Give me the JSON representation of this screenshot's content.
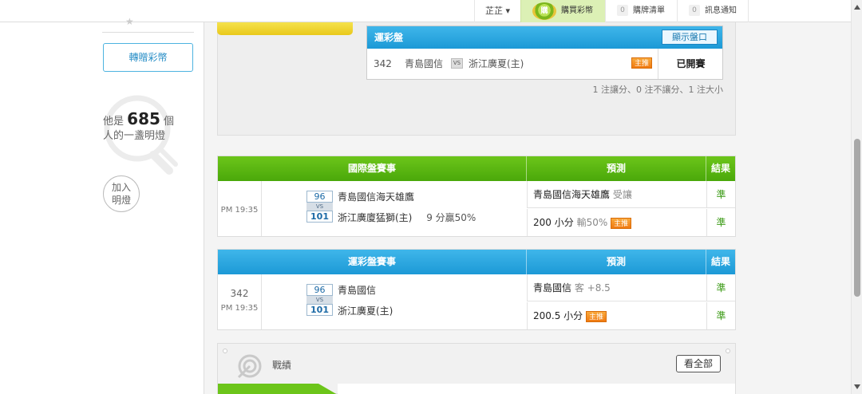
{
  "topbar": {
    "user_name": "芷芷",
    "user_caret": "▾",
    "buy_coin_badge": "購",
    "buy_label": "購買彩幣",
    "cart_count": "0",
    "cart_label": "購牌清單",
    "msg_count": "0",
    "msg_label": "訊息通知"
  },
  "sidebar": {
    "gift_button": "轉贈彩幣",
    "lamp_prefix": "他是",
    "lamp_count": "685",
    "lamp_unit": "個",
    "lamp_suffix": "人的一盞明燈",
    "join_line1": "加入",
    "join_line2": "明燈"
  },
  "lottery_panel": {
    "title": "運彩盤",
    "show_button": "顯示盤口",
    "game_no": "342",
    "team1": "青島國信",
    "vs": "VS",
    "team2": "浙江廣夏(主)",
    "badge": "主推",
    "status": "已開賽",
    "summary": "1 注讓分、0 注不讓分、1 注大小"
  },
  "intl_table": {
    "headers": [
      "國際盤賽事",
      "預測",
      "結果"
    ],
    "game_no": "",
    "time": "PM 19:35",
    "score1": "96",
    "vs": "VS",
    "score2": "101",
    "team1": "青島國信海天雄鷹",
    "team2": "浙江廣廈猛獅(主)",
    "team2_note": "9 分贏50%",
    "pred1_main": "青島國信海天雄鷹",
    "pred1_sub": "受讓",
    "pred2_main": "200 小分",
    "pred2_sub": "輸50%",
    "pred2_badge": "主推",
    "result1": "準",
    "result2": "準"
  },
  "lottery_table": {
    "headers": [
      "運彩盤賽事",
      "預測",
      "結果"
    ],
    "game_no": "342",
    "time": "PM 19:35",
    "score1": "96",
    "vs": "VS",
    "score2": "101",
    "team1": "青島國信",
    "team2": "浙江廣夏(主)",
    "pred1_main": "青島國信",
    "pred1_sub": "客 +8.5",
    "pred2_main": "200.5 小分",
    "pred2_badge": "主推",
    "result1": "準",
    "result2": "準"
  },
  "record": {
    "title": "戰績",
    "all_button": "看全部"
  },
  "colors": {
    "green_header": "#4aa80a",
    "blue_header": "#1c99d6",
    "badge_orange": "#f0790f",
    "result_green": "#3a9a14"
  }
}
